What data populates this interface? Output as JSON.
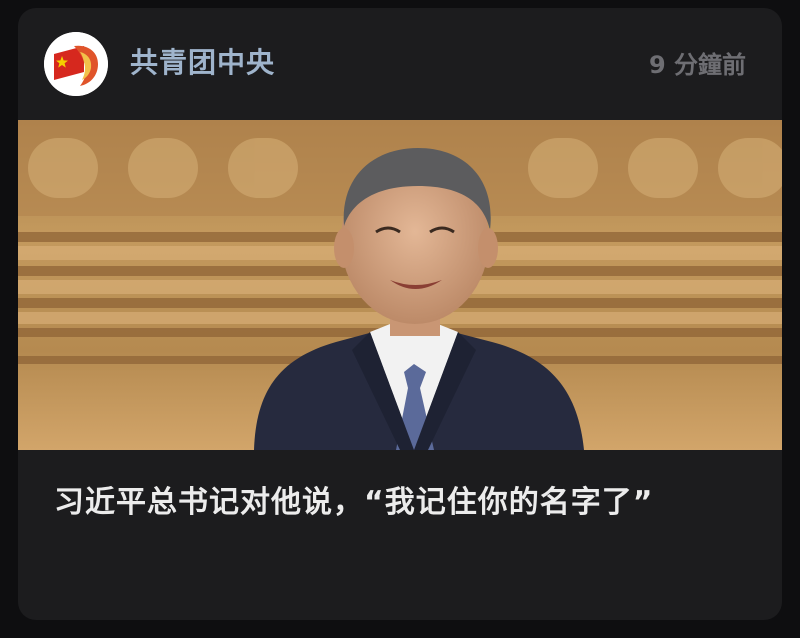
{
  "post": {
    "source_name": "共青团中央",
    "timestamp": "9 分鐘前",
    "headline": "习近平总书记对他说，“我记住你的名字了”"
  },
  "icons": {
    "avatar": "communist-youth-league-logo",
    "photo": "news-photo"
  },
  "colors": {
    "card_background": "#1c1c1e",
    "source_name": "#9fb4cc",
    "timestamp": "#6e6e73",
    "headline": "#ececec"
  }
}
